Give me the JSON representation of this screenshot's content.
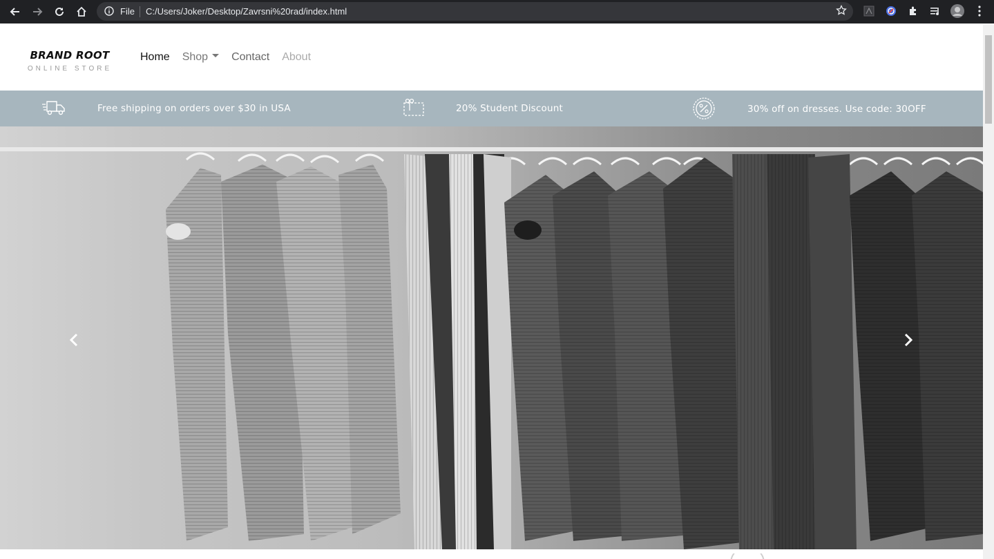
{
  "browser": {
    "file_label": "File",
    "url": "C:/Users/Joker/Desktop/Zavrsni%20rad/index.html"
  },
  "brand": {
    "name": "BRAND ROOT",
    "tagline": "ONLINE STORE"
  },
  "nav": {
    "home": "Home",
    "shop": "Shop",
    "contact": "Contact",
    "about": "About"
  },
  "promo": {
    "shipping": "Free shipping on orders over $30 in USA",
    "discount": "20% Student Discount",
    "dresses": "30% off on dresses. Use code: 30OFF"
  },
  "icons": {
    "shipping": "truck-icon",
    "discount": "coupon-icon",
    "dresses": "percent-badge-icon",
    "prev": "chevron-left-icon",
    "next": "chevron-right-icon"
  },
  "colors": {
    "promo_bar": "#a7b6be",
    "browser_chrome": "#202124"
  }
}
